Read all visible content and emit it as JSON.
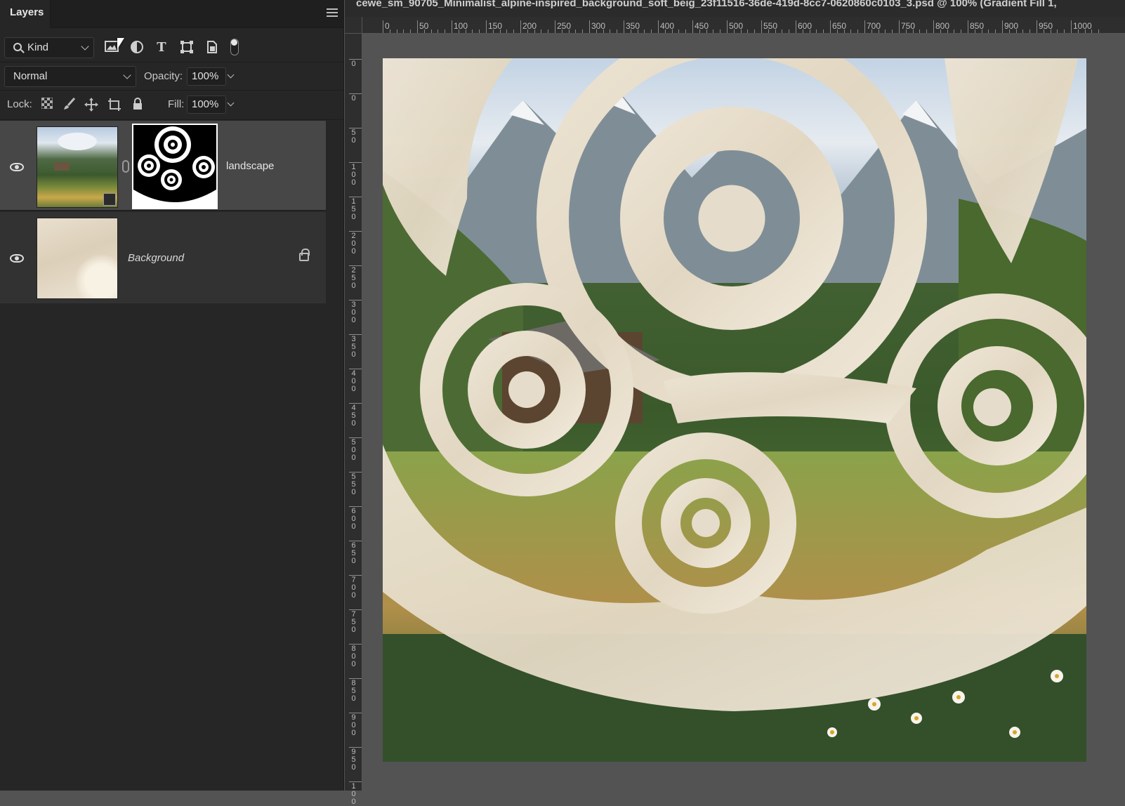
{
  "panel": {
    "tab": "Layers",
    "menu_icon": "hamburger-menu-icon",
    "filter": {
      "kind_label": "Kind",
      "icons": [
        "image-filter-icon",
        "adjustment-filter-icon",
        "type-filter-icon",
        "shape-filter-icon",
        "smart-object-filter-icon"
      ],
      "type_glyph": "T"
    },
    "blend_mode": "Normal",
    "opacity_label": "Opacity:",
    "opacity_value": "100%",
    "lock_label": "Lock:",
    "lock_icons": [
      "lock-transparent-icon",
      "lock-image-icon",
      "lock-position-icon",
      "lock-artboard-icon",
      "lock-all-icon"
    ],
    "fill_label": "Fill:",
    "fill_value": "100%"
  },
  "layers": [
    {
      "name": "landscape",
      "visible": true,
      "has_mask": true,
      "selected": true
    },
    {
      "name": "Background",
      "visible": true,
      "locked": true,
      "selected": false
    }
  ],
  "document": {
    "title": "cewe_sm_90705_Minimalist_alpine-inspired_background_soft_beig_23f11516-36de-419d-8cc7-0620860c0103_3.psd @ 100% (Gradient Fill 1,",
    "ruler_top": [
      "0",
      "50",
      "100",
      "150",
      "200",
      "250",
      "300",
      "350",
      "400",
      "450",
      "500",
      "550",
      "600",
      "650",
      "700",
      "750",
      "800",
      "850",
      "900",
      "950",
      "1000"
    ],
    "ruler_left": [
      "0",
      "0",
      "50",
      "100",
      "150",
      "200",
      "250",
      "300",
      "350",
      "400",
      "450",
      "500",
      "550",
      "600",
      "650",
      "700",
      "750",
      "800",
      "850",
      "900",
      "950",
      "100"
    ]
  },
  "colors": {
    "panel_bg": "#262626",
    "selected_layer": "#474747",
    "canvas_beige": "#e6dccb",
    "workspace": "#535353"
  }
}
